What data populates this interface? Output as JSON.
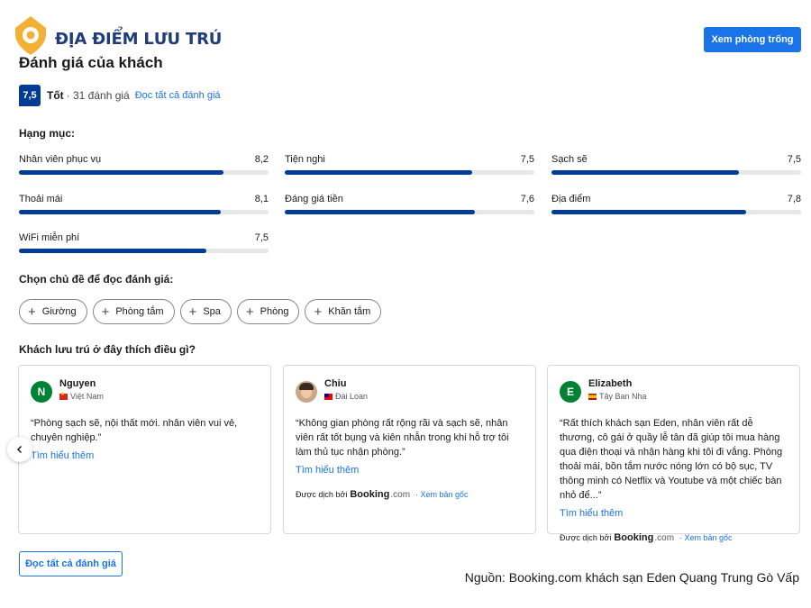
{
  "brand": {
    "name": "ĐỊA ĐIỂM LƯU TRÚ",
    "accent": "#f2b134",
    "text_color": "#1f3d7a"
  },
  "header": {
    "cta_label": "Xem phòng trống"
  },
  "title": "Đánh giá của khách",
  "score": {
    "value": "7,5",
    "word": "Tốt",
    "count": "· 31 đánh giá",
    "link": "Đọc tất cả đánh giá"
  },
  "categories_label": "Hạng mục:",
  "categories": [
    {
      "label": "Nhân viên phục vụ",
      "value": "8,2",
      "score": 8.2
    },
    {
      "label": "Tiện nghi",
      "value": "7,5",
      "score": 7.5
    },
    {
      "label": "Sạch sẽ",
      "value": "7,5",
      "score": 7.5
    },
    {
      "label": "Thoải mái",
      "value": "8,1",
      "score": 8.1
    },
    {
      "label": "Đáng giá tiền",
      "value": "7,6",
      "score": 7.6
    },
    {
      "label": "Địa điểm",
      "value": "7,8",
      "score": 7.8
    },
    {
      "label": "WiFi miễn phí",
      "value": "7,5",
      "score": 7.5
    }
  ],
  "topics_label": "Chọn chủ đề để đọc đánh giá:",
  "topics": [
    "Giường",
    "Phòng tắm",
    "Spa",
    "Phòng",
    "Khăn tắm"
  ],
  "liked_label": "Khách lưu trú ở đây thích điều gì?",
  "reviews": [
    {
      "initial": "N",
      "name": "Nguyen",
      "country": "Việt Nam",
      "text": "“Phòng sạch sẽ, nội thất mới. nhân viên vui vẻ, chuyên nghiệp.”",
      "more": "Tìm hiểu thêm"
    },
    {
      "initial": "",
      "name": "Chiu",
      "country": "Đài Loan",
      "text": "“Không gian phòng rất rộng rãi và sạch sẽ, nhân viên rất tốt bụng và kiên nhẫn trong khi hỗ trợ tôi làm thủ tục nhận phòng.”",
      "more": "Tìm hiểu thêm",
      "translated_by": "Được dịch bởi",
      "booking": "Booking",
      "booking_com": ".com",
      "original": "· Xem bản gốc"
    },
    {
      "initial": "E",
      "name": "Elizabeth",
      "country": "Tây Ban Nha",
      "text": "“Rất thích khách sạn Eden, nhân viên rất dễ thương, cô gái ở quầy lễ tân đã giúp tôi mua hàng qua điện thoại và nhận hàng khi tôi đi vắng. Phòng thoải mái, bồn tắm nước nóng lớn có bộ sục, TV thông minh có Netflix và Youtube và một chiếc bàn nhỏ để...”",
      "more": "Tìm hiểu thêm",
      "translated_by": "Được dịch bởi",
      "booking": "Booking",
      "booking_com": ".com",
      "original": "· Xem bản gốc"
    }
  ],
  "read_all_label": "Đọc tất cả đánh giá",
  "source": "Nguồn: Booking.com khách sạn Eden Quang Trung Gò Vấp",
  "colors": {
    "primary": "#003b95",
    "link": "#1a73e8",
    "bar_track": "#e7e7e7"
  },
  "icons": {
    "logo": "location-pin-house-icon",
    "chip": "plus-icon",
    "carousel": "chevron-left-icon"
  }
}
